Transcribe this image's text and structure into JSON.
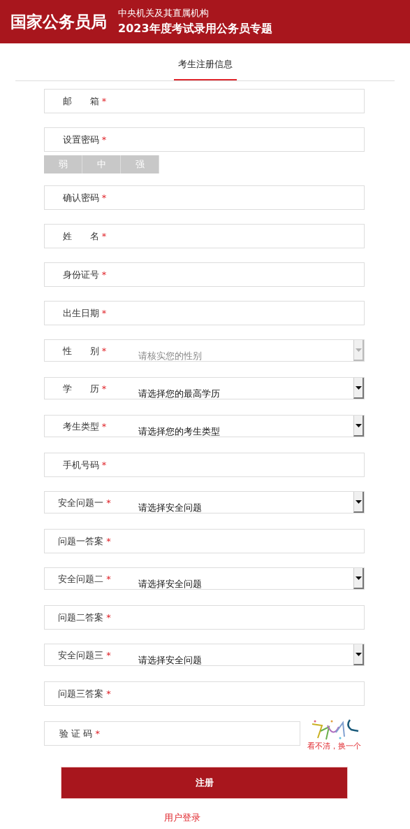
{
  "header": {
    "logo": "国家公务员局",
    "subtitle": "中央机关及其直属机构",
    "title": "2023年度考试录用公务员专题"
  },
  "tabs": [
    {
      "label": "考生注册信息",
      "selected": true
    }
  ],
  "fields": [
    {
      "kind": "text",
      "label": "邮　　箱",
      "mark": "*"
    },
    {
      "kind": "text",
      "label": "设置密码",
      "mark": "*",
      "strength": [
        {
          "label": "弱",
          "on": false
        },
        {
          "label": "中",
          "on": false
        },
        {
          "label": "强",
          "on": false
        }
      ]
    },
    {
      "kind": "text",
      "label": "确认密码",
      "mark": "*"
    },
    {
      "kind": "text",
      "label": "姓　　名",
      "mark": "*"
    },
    {
      "kind": "text",
      "label": "身份证号",
      "mark": "*"
    },
    {
      "kind": "text",
      "label": "出生日期",
      "mark": "*"
    },
    {
      "kind": "select",
      "label": "性　　别",
      "mark": "*",
      "value": "请核实您的性别",
      "disabled": true
    },
    {
      "kind": "select",
      "label": "学　　历",
      "mark": "*",
      "value": "请选择您的最高学历",
      "disabled": false
    },
    {
      "kind": "select",
      "label": "考生类型",
      "mark": "*",
      "value": "请选择您的考生类型",
      "disabled": false
    },
    {
      "kind": "text",
      "label": "手机号码",
      "mark": "*"
    },
    {
      "kind": "select",
      "label": "安全问题一",
      "mark": "*",
      "value": "请选择安全问题",
      "disabled": false
    },
    {
      "kind": "text",
      "label": "问题一答案",
      "mark": "*"
    },
    {
      "kind": "select",
      "label": "安全问题二",
      "mark": "*",
      "value": "请选择安全问题",
      "disabled": false
    },
    {
      "kind": "text",
      "label": "问题二答案",
      "mark": "*"
    },
    {
      "kind": "select",
      "label": "安全问题三",
      "mark": "*",
      "value": "请选择安全问题",
      "disabled": false
    },
    {
      "kind": "text",
      "label": "问题三答案",
      "mark": "*"
    }
  ],
  "captcha": {
    "label": "验 证 码",
    "mark": "*",
    "refresh": "看不清，换一个"
  },
  "submit": "注册",
  "login_link": "用户登录"
}
